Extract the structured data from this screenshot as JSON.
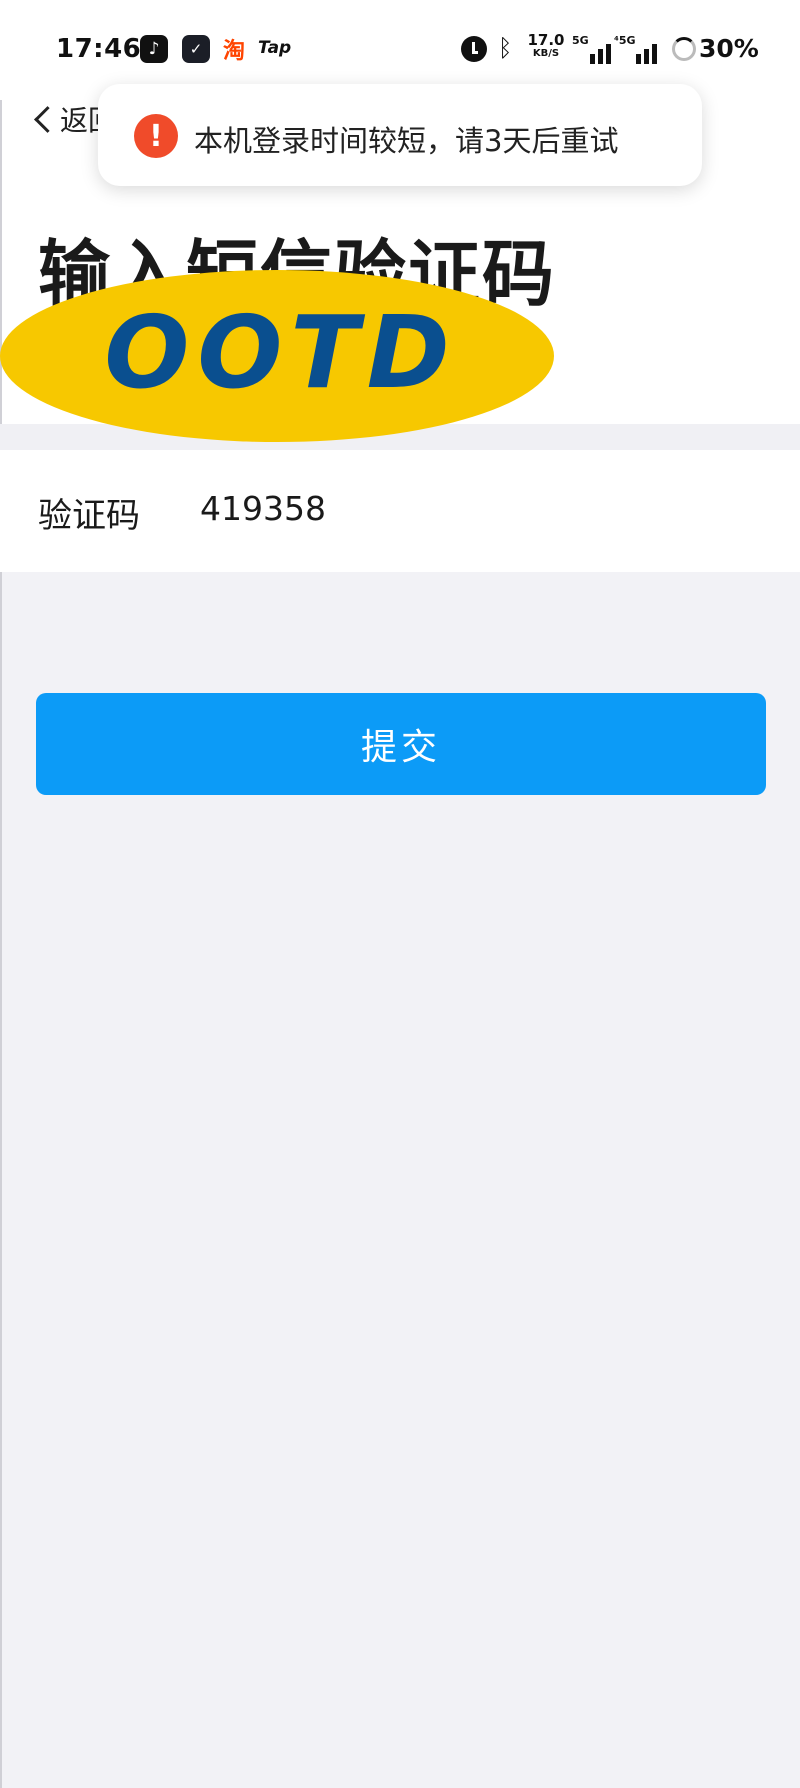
{
  "status_bar": {
    "time": "17:46",
    "apps": [
      {
        "name": "tiktok-icon",
        "glyph": "♪"
      },
      {
        "name": "mail-icon",
        "glyph": "✓"
      },
      {
        "name": "taobao-icon",
        "glyph": "淘"
      }
    ],
    "tap_label": "Tap",
    "net_speed": "17.0",
    "net_unit": "KB/S",
    "sim1_label": "5G",
    "sim2_label": "⁴5G",
    "battery": "30%"
  },
  "header": {
    "back_label": "返回",
    "title": "输入短信验证码"
  },
  "toast": {
    "icon": "!",
    "message": "本机登录时间较短，请3天后重试",
    "color": "#f04b2a"
  },
  "sticker": {
    "text": "OOTD",
    "fill": "#f7c800",
    "text_color": "#0a4f8f"
  },
  "form": {
    "code_label": "验证码",
    "code_value": "419358"
  },
  "submit": {
    "label": "提交",
    "color": "#0c9bf7"
  }
}
